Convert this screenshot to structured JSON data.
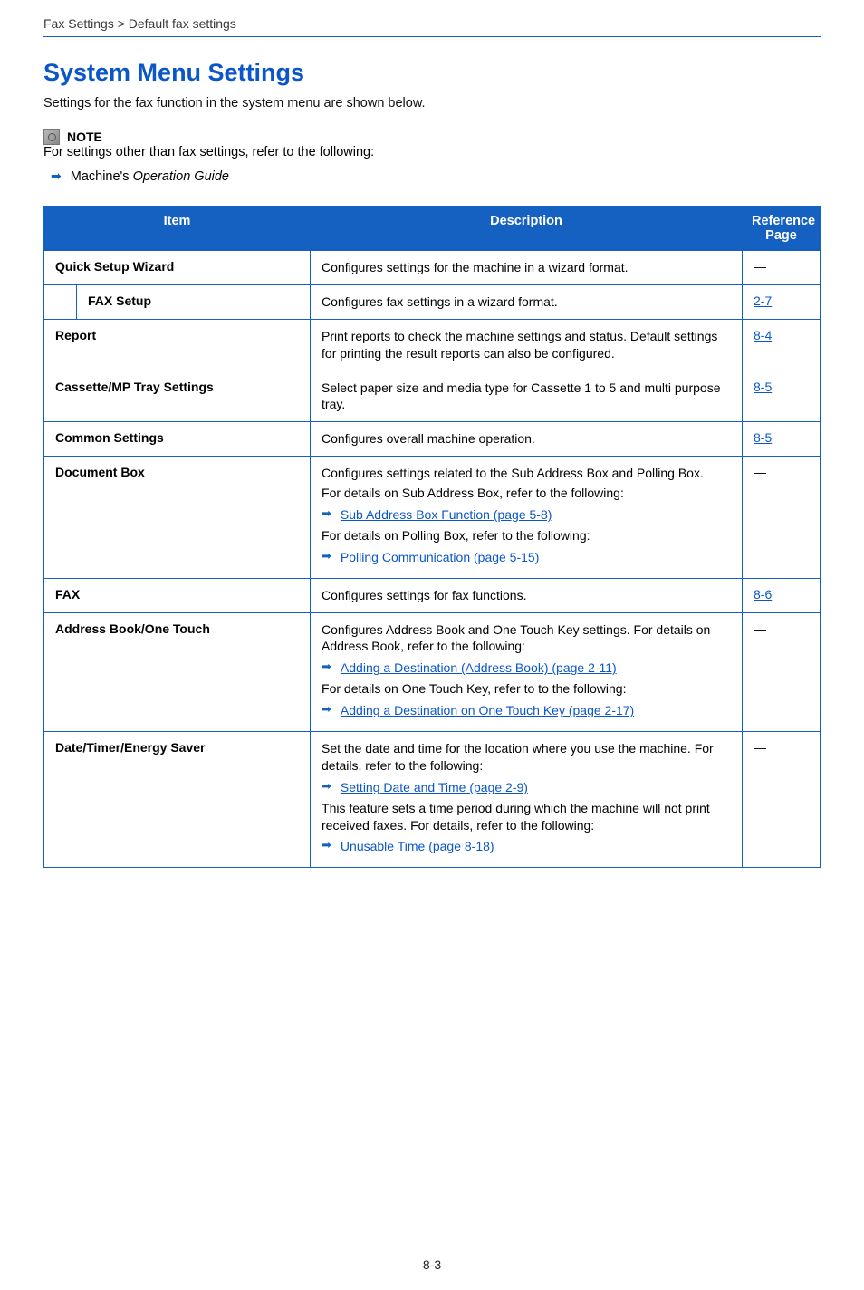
{
  "breadcrumb": "Fax Settings > Default fax settings",
  "title": "System Menu Settings",
  "intro": "Settings for the fax function in the system menu are shown below.",
  "note_label": "NOTE",
  "note_text": "For settings other than fax settings, refer to the following:",
  "guide_prefix": "Machine's ",
  "guide_italic": "Operation Guide",
  "headers": {
    "item": "Item",
    "description": "Description",
    "ref": "Reference Page"
  },
  "page_number": "8-3",
  "rows": {
    "quick_setup": {
      "item": "Quick Setup Wizard",
      "desc": "Configures settings for the machine in a wizard format.",
      "ref": "—"
    },
    "fax_setup": {
      "item": "FAX Setup",
      "desc": "Configures fax settings in a wizard format.",
      "ref": "2-7"
    },
    "report": {
      "item": "Report",
      "desc": "Print reports to check the machine settings and status. Default settings for printing the result reports can also be configured.",
      "ref": "8-4"
    },
    "cassette": {
      "item": "Cassette/MP Tray Settings",
      "desc": "Select paper size and media type for Cassette 1 to 5 and multi purpose tray.",
      "ref": "8-5"
    },
    "common": {
      "item": "Common Settings",
      "desc": "Configures overall machine operation.",
      "ref": "8-5"
    },
    "docbox": {
      "item": "Document Box",
      "line1": "Configures settings related to the Sub Address Box and Polling Box.",
      "line2": "For details on Sub Address Box, refer to the following:",
      "link1": "Sub Address Box Function (page 5-8)",
      "line3": "For details on Polling Box, refer to the following:",
      "link2": "Polling Communication (page 5-15)",
      "ref": "—"
    },
    "fax": {
      "item": "FAX",
      "desc": "Configures settings for fax functions.",
      "ref": "8-6"
    },
    "addrbook": {
      "item": "Address Book/One Touch",
      "line1": "Configures Address Book and One Touch Key settings. For details on Address Book, refer to the following:",
      "link1": "Adding a Destination (Address Book) (page 2-11)",
      "line2": "For details on One Touch Key, refer to to the following:",
      "link2": "Adding a Destination on One Touch Key (page 2-17)",
      "ref": "—"
    },
    "datetime": {
      "item": "Date/Timer/Energy Saver",
      "line1": "Set the date and time for the location where you use the machine. For details, refer to the following:",
      "link1": "Setting Date and Time (page 2-9)",
      "line2": "This feature sets a time period during which the machine will not print received faxes. For details, refer to the following:",
      "link2": "Unusable Time (page 8-18)",
      "ref": "—"
    }
  }
}
